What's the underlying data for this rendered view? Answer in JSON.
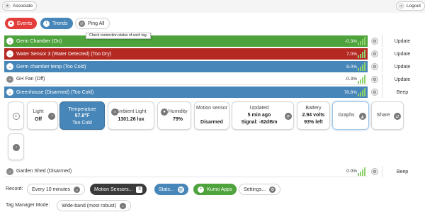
{
  "topbar": {
    "associate_label": "Associate",
    "logout_label": "Logout"
  },
  "toolbar": {
    "events_label": "Events",
    "trends_label": "Trends",
    "ping_label": "Ping All"
  },
  "tooltip": "Check connection status of each tag.",
  "tags": [
    {
      "name": "Germ Chamber (On)",
      "signal": "-0.3%",
      "action": "Update",
      "color": "#4ea33d"
    },
    {
      "name": "Water Sensor 3 (Water Detected) (Too Dry)",
      "signal": "7.0%",
      "action": "Update",
      "color": "#b42a23"
    },
    {
      "name": "Germ chamber temp (Too Cold)",
      "signal": "8.0%",
      "action": "Update",
      "color": "#4786b8"
    },
    {
      "name": "GH Fan (Off)",
      "signal": "-0.3%",
      "action": "Update",
      "color": "#ffffff"
    },
    {
      "name": "Greenhouse (Disarmed) (Too Cold)",
      "signal": "78.8%",
      "action": "Beep",
      "color": "#4786b8"
    }
  ],
  "detail": {
    "light_label": "Light",
    "light_value": "Off",
    "temp_label": "Temperature",
    "temp_value": "57.8°F",
    "temp_status": "Too Cold",
    "ambient_label": "Ambient Light",
    "ambient_value": "1301.26 lux",
    "humidity_label": "Humidity",
    "humidity_value": "79%",
    "motion_label": "Motion sensor",
    "motion_value": "Disarmed",
    "updated_label": "Updated",
    "updated_value": "5 min ago",
    "updated_signal": "Signal: -82dBm",
    "battery_label": "Battery",
    "battery_value": "2.94 volts",
    "battery_left": "93% left",
    "graphs_label": "Graphs",
    "share_label": "Share"
  },
  "shed": {
    "name": "Garden Shed (Disarmed)",
    "signal": "0.0%",
    "action": "Beep"
  },
  "record": {
    "label": "Record:",
    "interval": "Every 10 minutes",
    "motion_btn": "Motion Sensors...",
    "stats_btn": "Stats...",
    "kumo_btn": "Kumo Apps",
    "settings_btn": "Settings..."
  },
  "mode": {
    "label": "Tag Manager Mode:",
    "value": "Wide-band (most robust)"
  },
  "colors": {
    "green": "#4ea33d",
    "red": "#b42a23",
    "blue": "#4786b8",
    "temp_tile": "#4786b8"
  }
}
